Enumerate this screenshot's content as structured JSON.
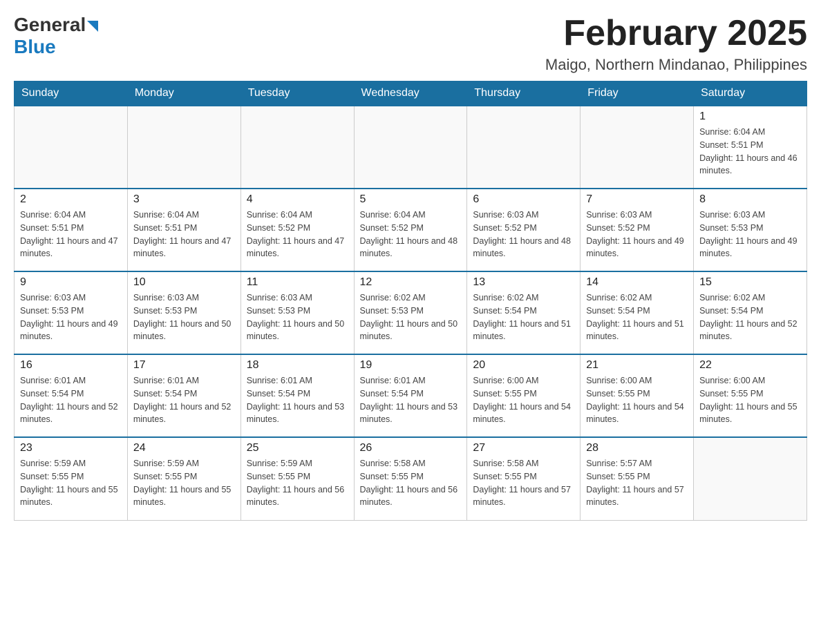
{
  "logo": {
    "general": "General",
    "blue": "Blue"
  },
  "title": "February 2025",
  "location": "Maigo, Northern Mindanao, Philippines",
  "weekdays": [
    "Sunday",
    "Monday",
    "Tuesday",
    "Wednesday",
    "Thursday",
    "Friday",
    "Saturday"
  ],
  "weeks": [
    [
      {
        "day": "",
        "info": ""
      },
      {
        "day": "",
        "info": ""
      },
      {
        "day": "",
        "info": ""
      },
      {
        "day": "",
        "info": ""
      },
      {
        "day": "",
        "info": ""
      },
      {
        "day": "",
        "info": ""
      },
      {
        "day": "1",
        "info": "Sunrise: 6:04 AM\nSunset: 5:51 PM\nDaylight: 11 hours and 46 minutes."
      }
    ],
    [
      {
        "day": "2",
        "info": "Sunrise: 6:04 AM\nSunset: 5:51 PM\nDaylight: 11 hours and 47 minutes."
      },
      {
        "day": "3",
        "info": "Sunrise: 6:04 AM\nSunset: 5:51 PM\nDaylight: 11 hours and 47 minutes."
      },
      {
        "day": "4",
        "info": "Sunrise: 6:04 AM\nSunset: 5:52 PM\nDaylight: 11 hours and 47 minutes."
      },
      {
        "day": "5",
        "info": "Sunrise: 6:04 AM\nSunset: 5:52 PM\nDaylight: 11 hours and 48 minutes."
      },
      {
        "day": "6",
        "info": "Sunrise: 6:03 AM\nSunset: 5:52 PM\nDaylight: 11 hours and 48 minutes."
      },
      {
        "day": "7",
        "info": "Sunrise: 6:03 AM\nSunset: 5:52 PM\nDaylight: 11 hours and 49 minutes."
      },
      {
        "day": "8",
        "info": "Sunrise: 6:03 AM\nSunset: 5:53 PM\nDaylight: 11 hours and 49 minutes."
      }
    ],
    [
      {
        "day": "9",
        "info": "Sunrise: 6:03 AM\nSunset: 5:53 PM\nDaylight: 11 hours and 49 minutes."
      },
      {
        "day": "10",
        "info": "Sunrise: 6:03 AM\nSunset: 5:53 PM\nDaylight: 11 hours and 50 minutes."
      },
      {
        "day": "11",
        "info": "Sunrise: 6:03 AM\nSunset: 5:53 PM\nDaylight: 11 hours and 50 minutes."
      },
      {
        "day": "12",
        "info": "Sunrise: 6:02 AM\nSunset: 5:53 PM\nDaylight: 11 hours and 50 minutes."
      },
      {
        "day": "13",
        "info": "Sunrise: 6:02 AM\nSunset: 5:54 PM\nDaylight: 11 hours and 51 minutes."
      },
      {
        "day": "14",
        "info": "Sunrise: 6:02 AM\nSunset: 5:54 PM\nDaylight: 11 hours and 51 minutes."
      },
      {
        "day": "15",
        "info": "Sunrise: 6:02 AM\nSunset: 5:54 PM\nDaylight: 11 hours and 52 minutes."
      }
    ],
    [
      {
        "day": "16",
        "info": "Sunrise: 6:01 AM\nSunset: 5:54 PM\nDaylight: 11 hours and 52 minutes."
      },
      {
        "day": "17",
        "info": "Sunrise: 6:01 AM\nSunset: 5:54 PM\nDaylight: 11 hours and 52 minutes."
      },
      {
        "day": "18",
        "info": "Sunrise: 6:01 AM\nSunset: 5:54 PM\nDaylight: 11 hours and 53 minutes."
      },
      {
        "day": "19",
        "info": "Sunrise: 6:01 AM\nSunset: 5:54 PM\nDaylight: 11 hours and 53 minutes."
      },
      {
        "day": "20",
        "info": "Sunrise: 6:00 AM\nSunset: 5:55 PM\nDaylight: 11 hours and 54 minutes."
      },
      {
        "day": "21",
        "info": "Sunrise: 6:00 AM\nSunset: 5:55 PM\nDaylight: 11 hours and 54 minutes."
      },
      {
        "day": "22",
        "info": "Sunrise: 6:00 AM\nSunset: 5:55 PM\nDaylight: 11 hours and 55 minutes."
      }
    ],
    [
      {
        "day": "23",
        "info": "Sunrise: 5:59 AM\nSunset: 5:55 PM\nDaylight: 11 hours and 55 minutes."
      },
      {
        "day": "24",
        "info": "Sunrise: 5:59 AM\nSunset: 5:55 PM\nDaylight: 11 hours and 55 minutes."
      },
      {
        "day": "25",
        "info": "Sunrise: 5:59 AM\nSunset: 5:55 PM\nDaylight: 11 hours and 56 minutes."
      },
      {
        "day": "26",
        "info": "Sunrise: 5:58 AM\nSunset: 5:55 PM\nDaylight: 11 hours and 56 minutes."
      },
      {
        "day": "27",
        "info": "Sunrise: 5:58 AM\nSunset: 5:55 PM\nDaylight: 11 hours and 57 minutes."
      },
      {
        "day": "28",
        "info": "Sunrise: 5:57 AM\nSunset: 5:55 PM\nDaylight: 11 hours and 57 minutes."
      },
      {
        "day": "",
        "info": ""
      }
    ]
  ]
}
